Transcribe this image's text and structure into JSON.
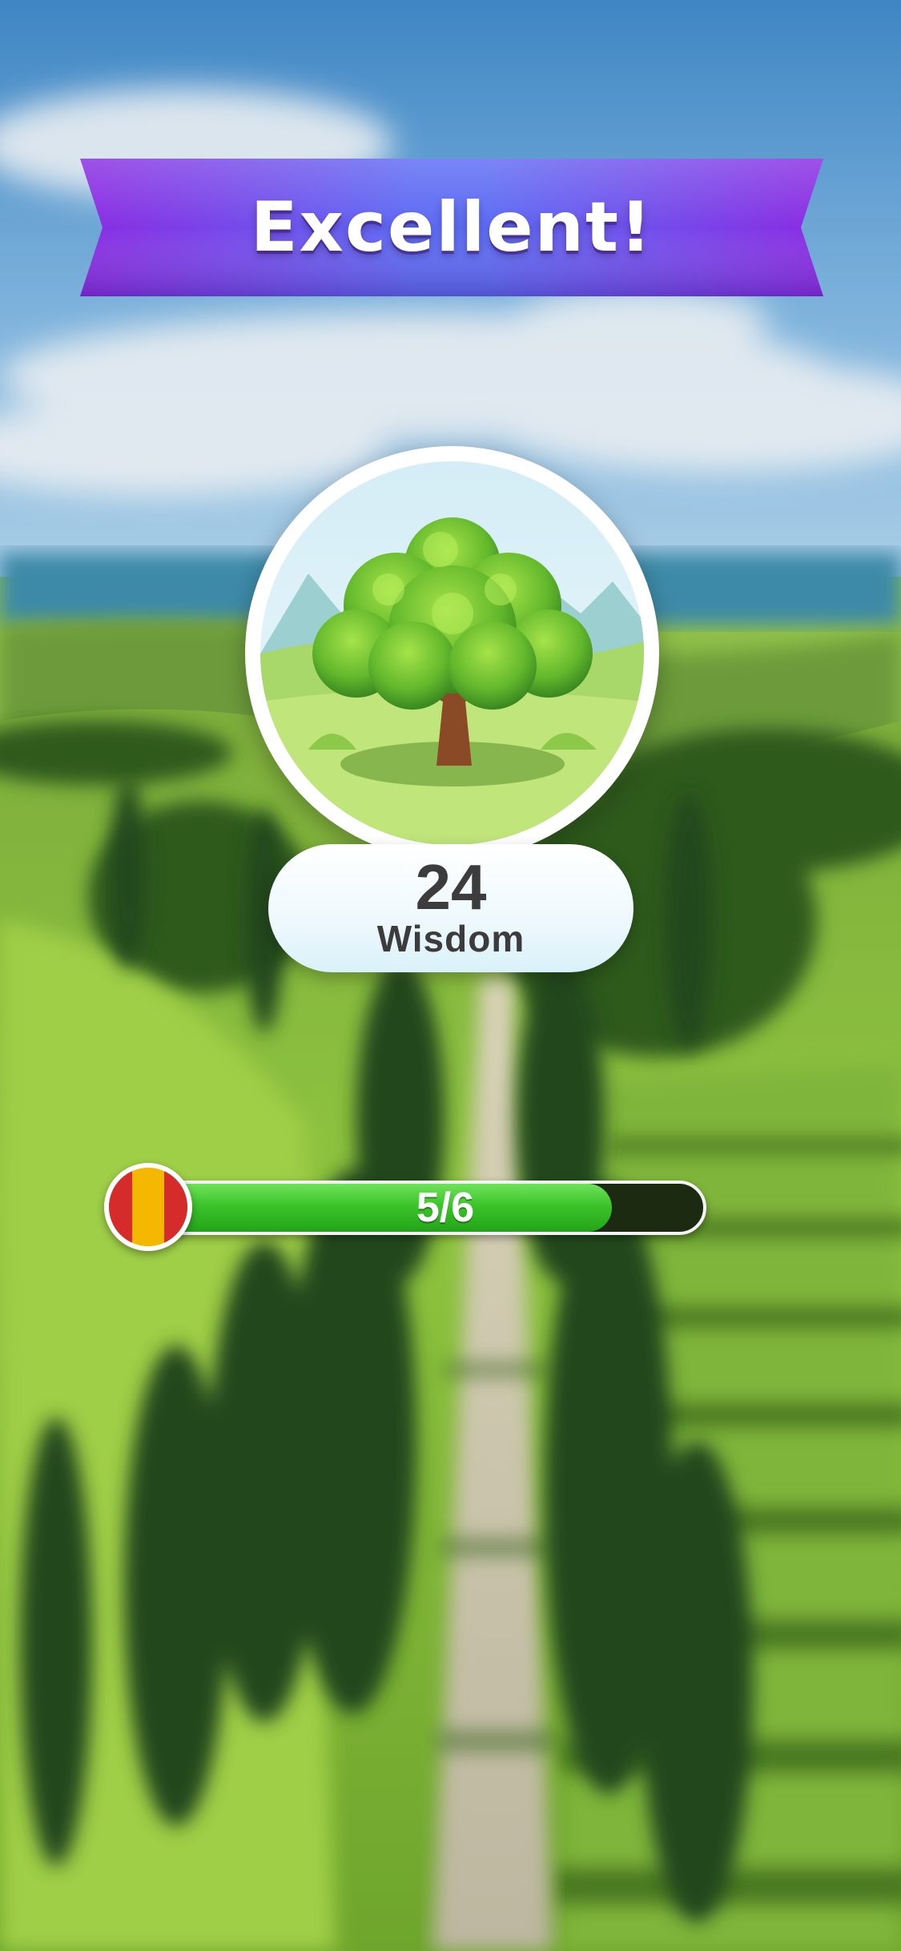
{
  "banner": {
    "title": "Excellent!"
  },
  "stat": {
    "value": "24",
    "label": "Wisdom"
  },
  "progress": {
    "text": "5/6",
    "current": 5,
    "total": 6,
    "fill_fraction": 0.833
  },
  "flag": {
    "stripes": [
      "#d62b2b",
      "#f5b800",
      "#d62b2b"
    ]
  },
  "colors": {
    "banner_purple": "#7b2ff7",
    "banner_blue": "#4f6bf5",
    "progress_green": "#3cc42b",
    "text_dark": "#3c3c3c"
  },
  "icons": {
    "medallion": "tree-illustration",
    "flag": "flag-icon"
  }
}
